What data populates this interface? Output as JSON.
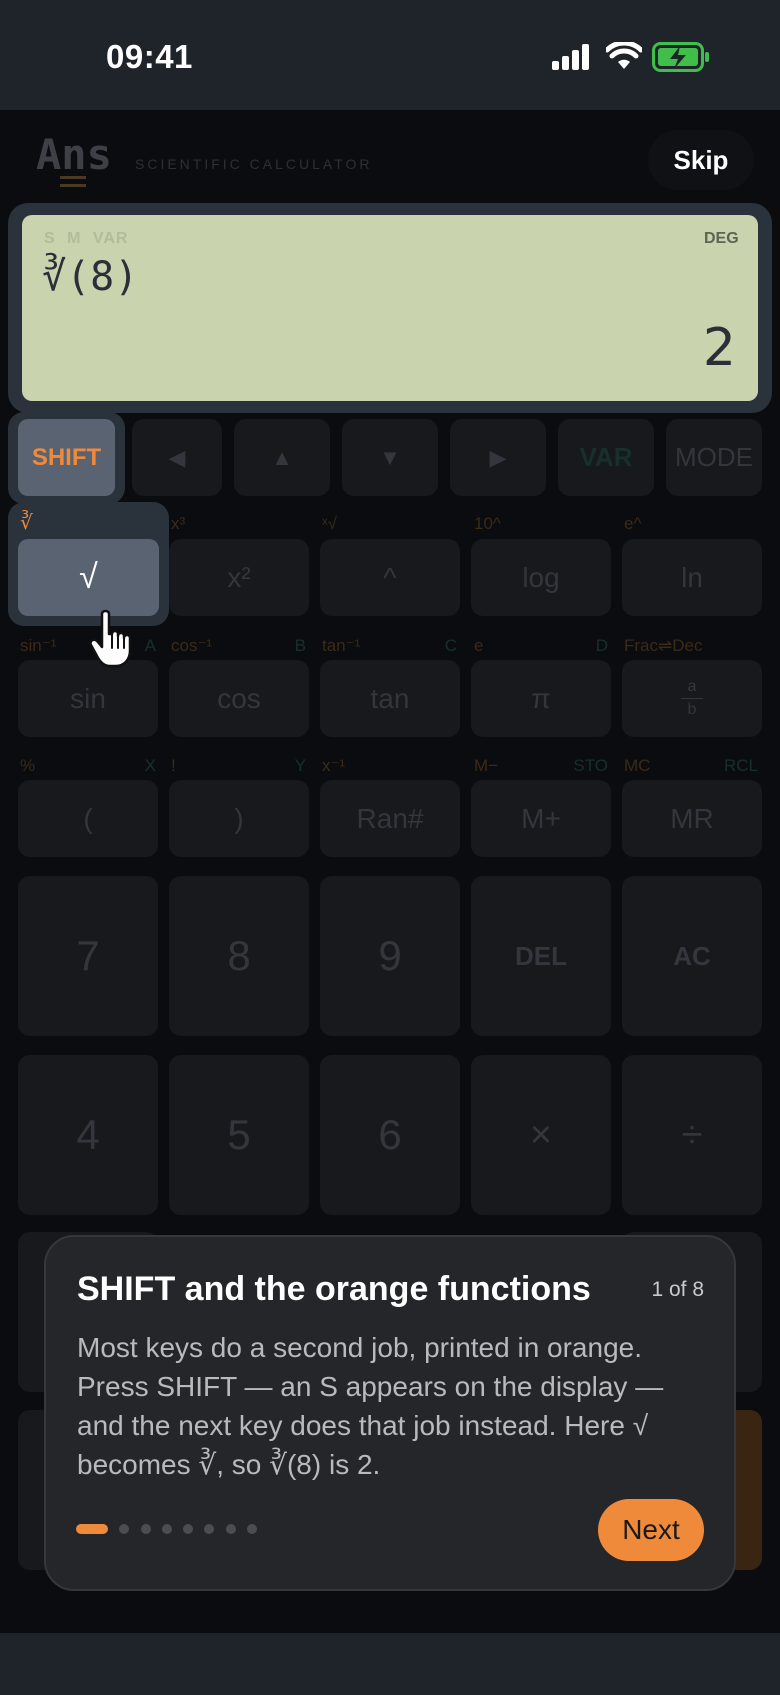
{
  "status": {
    "time": "09:41"
  },
  "header": {
    "logo": "Ans",
    "subtitle": "SCIENTIFIC CALCULATOR",
    "skip_label": "Skip"
  },
  "display": {
    "indicators": "S M VAR",
    "angle_mode": "DEG",
    "expression": "∛(8)",
    "result": "2"
  },
  "row_nav": {
    "shift": "SHIFT",
    "left": "◀",
    "up": "▲",
    "down": "▼",
    "right": "▶",
    "var": "VAR",
    "mode": "MODE"
  },
  "row1": {
    "keys": [
      "√",
      "x²",
      "^",
      "log",
      "ln"
    ],
    "shift_labels": [
      "∛",
      "x³",
      "ˣ√",
      "10^",
      "e^"
    ]
  },
  "row2": {
    "keys": [
      "sin",
      "cos",
      "tan",
      "π",
      "a/b"
    ],
    "shift_labels": [
      "sin⁻¹",
      "cos⁻¹",
      "tan⁻¹",
      "e",
      "Frac⇌Dec"
    ],
    "alpha_labels": [
      "A",
      "B",
      "C",
      "D",
      ""
    ],
    "frac_top": "a",
    "frac_bottom": "b"
  },
  "row3": {
    "keys": [
      "(",
      ")",
      "Ran#",
      "M+",
      "MR"
    ],
    "shift_labels": [
      "%",
      "!",
      "x⁻¹",
      "M−",
      "MC"
    ],
    "alpha_labels": [
      "X",
      "Y",
      "",
      "STO",
      "RCL"
    ]
  },
  "row4": {
    "keys": [
      "7",
      "8",
      "9",
      "DEL",
      "AC"
    ]
  },
  "row5": {
    "keys": [
      "4",
      "5",
      "6",
      "×",
      "÷"
    ]
  },
  "tutorial": {
    "title": "SHIFT and the orange functions",
    "step": "1 of 8",
    "body": "Most keys do a second job, printed in orange. Press SHIFT — an S appears on the display — and the next key does that job instead. Here √ becomes ∛, so ∛(8) is 2.",
    "next_label": "Next",
    "total_steps": 8,
    "current_step": 1
  },
  "colors": {
    "accent": "#ef8a3b",
    "lcd": "#c9d3ae",
    "card": "#242629"
  }
}
